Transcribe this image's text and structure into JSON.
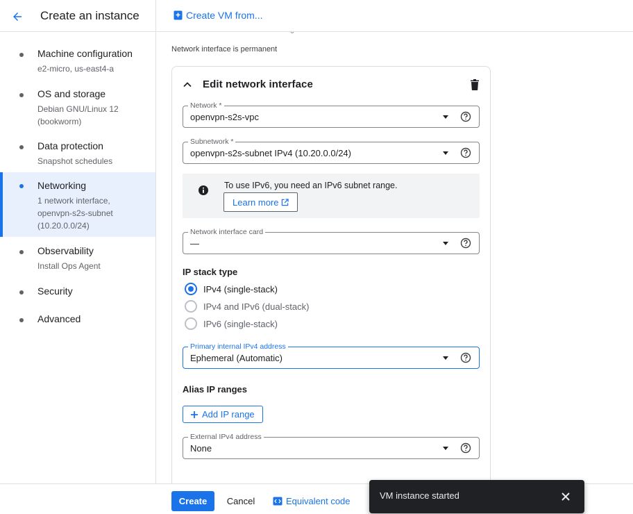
{
  "header": {
    "title": "Create an instance",
    "create_from_label": "Create VM from..."
  },
  "sidebar": {
    "items": [
      {
        "label": "Machine configuration",
        "sub": "e2-micro, us-east4-a"
      },
      {
        "label": "OS and storage",
        "sub": "Debian GNU/Linux 12 (bookworm)"
      },
      {
        "label": "Data protection",
        "sub": "Snapshot schedules"
      },
      {
        "label": "Networking",
        "sub": "1 network interface, openvpn-s2s-subnet (10.20.0.0/24)",
        "active": true
      },
      {
        "label": "Observability",
        "sub": "Install Ops Agent"
      },
      {
        "label": "Security",
        "sub": ""
      },
      {
        "label": "Advanced",
        "sub": ""
      }
    ]
  },
  "main": {
    "permanent_note": "Network interface is permanent",
    "card_title": "Edit network interface",
    "network": {
      "label": "Network *",
      "value": "openvpn-s2s-vpc"
    },
    "subnetwork": {
      "label": "Subnetwork *",
      "value": "openvpn-s2s-subnet IPv4 (10.20.0.0/24)"
    },
    "info": {
      "text": "To use IPv6, you need an IPv6 subnet range.",
      "learn_more": "Learn more"
    },
    "nic": {
      "label": "Network interface card",
      "value": "—"
    },
    "ip_stack": {
      "title": "IP stack type",
      "options": [
        {
          "label": "IPv4 (single-stack)",
          "checked": true
        },
        {
          "label": "IPv4 and IPv6 (dual-stack)",
          "checked": false
        },
        {
          "label": "IPv6 (single-stack)",
          "checked": false
        }
      ]
    },
    "primary_ipv4": {
      "label": "Primary internal IPv4 address",
      "value": "Ephemeral (Automatic)"
    },
    "alias": {
      "title": "Alias IP ranges",
      "add_label": "Add IP range"
    },
    "external_ipv4": {
      "label": "External IPv4 address",
      "value": "None"
    }
  },
  "footer": {
    "create_label": "Create",
    "cancel_label": "Cancel",
    "equivalent_label": "Equivalent code"
  },
  "toast": {
    "message": "VM instance started"
  },
  "colors": {
    "accent": "#1a73e8",
    "active_bg": "#e8f0fe",
    "toast_bg": "#202124"
  }
}
